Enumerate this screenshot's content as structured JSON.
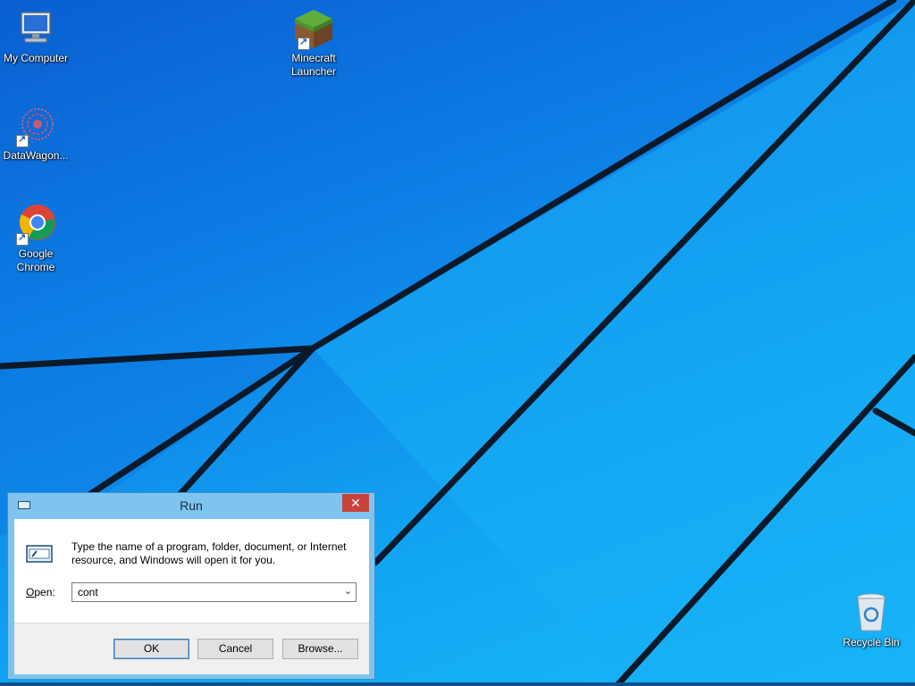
{
  "desktop": {
    "icons": [
      {
        "label": "My Computer",
        "icon": "computer-icon"
      },
      {
        "label": "DataWagon...",
        "icon": "datawagon-icon"
      },
      {
        "label": "Google Chrome",
        "icon": "chrome-icon"
      },
      {
        "label": "Minecraft Launcher",
        "icon": "minecraft-icon"
      },
      {
        "label": "Recycle Bin",
        "icon": "recycle-bin-icon"
      }
    ]
  },
  "run_dialog": {
    "title": "Run",
    "close_label": "✕",
    "description": "Type the name of a program, folder, document, or Internet resource, and Windows will open it for you.",
    "open_label_mnemonic": "O",
    "open_label_rest": "pen:",
    "open_value": "cont",
    "ok_label": "OK",
    "cancel_label": "Cancel",
    "browse_label": "Browse..."
  },
  "colors": {
    "wallpaper": "#0d7fe6",
    "dialog_frame": "#7ec4ef",
    "close_button": "#c7423a"
  }
}
